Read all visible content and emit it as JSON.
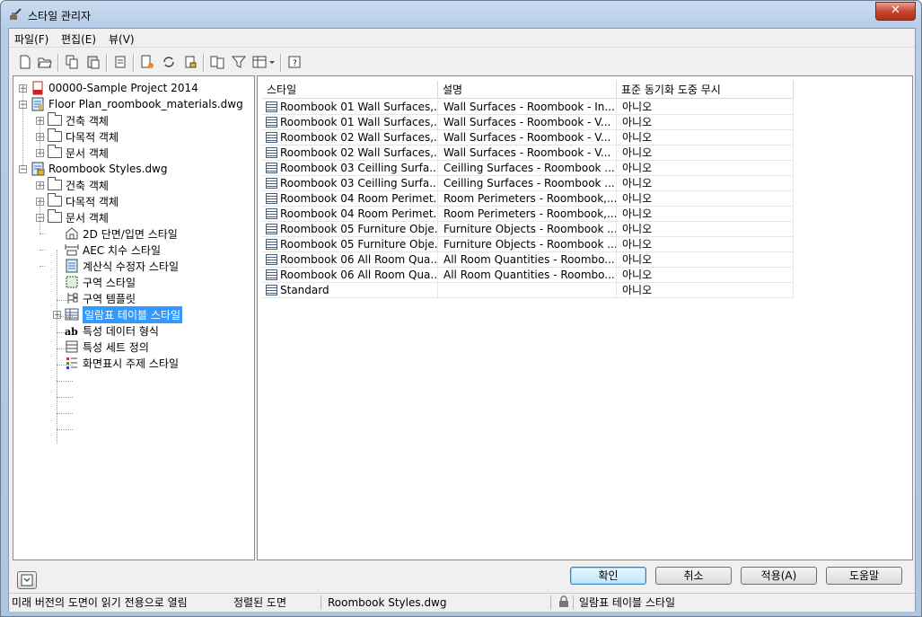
{
  "window": {
    "title": "스타일 관리자",
    "close_label": "✕"
  },
  "menu": [
    "파일(F)",
    "편집(E)",
    "뷰(V)"
  ],
  "toolbar": [
    "new-icon",
    "open-icon",
    "copy-icon",
    "paste-icon",
    "purge-icon",
    "edit-style-icon",
    "sync-icon",
    "lock-icon",
    "compare-icon",
    "filter-icon",
    "view-options-icon",
    "help-icon"
  ],
  "tree": [
    {
      "label": "00000-Sample Project 2014",
      "icon": "project-icon",
      "expander": "+"
    },
    {
      "label": "Floor Plan_roombook_materials.dwg",
      "icon": "drawing-icon",
      "expander": "−"
    },
    {
      "label": "건축 객체",
      "icon": "folder-icon",
      "expander": "+"
    },
    {
      "label": "다목적 객체",
      "icon": "folder-icon",
      "expander": "+"
    },
    {
      "label": "문서 객체",
      "icon": "folder-icon",
      "expander": "+"
    },
    {
      "label": "Roombook Styles.dwg",
      "icon": "locked-drawing-icon",
      "expander": "−"
    },
    {
      "label": "건축 객체",
      "icon": "folder-icon",
      "expander": "+"
    },
    {
      "label": "다목적 객체",
      "icon": "folder-icon",
      "expander": "+"
    },
    {
      "label": "문서 객체",
      "icon": "folder-icon",
      "expander": "−"
    },
    {
      "label": "2D 단면/입면 스타일",
      "icon": "section-icon"
    },
    {
      "label": "AEC 치수 스타일",
      "icon": "dimension-icon"
    },
    {
      "label": "계산식 수정자 스타일",
      "icon": "calculation-icon"
    },
    {
      "label": "구역 스타일",
      "icon": "zone-icon"
    },
    {
      "label": "구역 템플릿",
      "icon": "zone-template-icon"
    },
    {
      "label": "일람표 테이블 스타일",
      "icon": "schedule-table-icon",
      "expander": "+",
      "selected": true
    },
    {
      "label": "특성 데이터 형식",
      "icon": "property-format-icon"
    },
    {
      "label": "특성 세트 정의",
      "icon": "property-set-icon"
    },
    {
      "label": "화면표시 주제 스타일",
      "icon": "display-theme-icon"
    }
  ],
  "list": {
    "columns": [
      "스타일",
      "설명",
      "표준 동기화 도중 무시"
    ],
    "rows": [
      [
        "Roombook 01 Wall Surfaces,...",
        "Wall Surfaces - Roombook - In...",
        "아니오"
      ],
      [
        "Roombook 01 Wall Surfaces,...",
        "Wall Surfaces - Roombook - V...",
        "아니오"
      ],
      [
        "Roombook 02 Wall Surfaces,...",
        "Wall Surfaces - Roombook - V...",
        "아니오"
      ],
      [
        "Roombook 02 Wall Surfaces,...",
        "Wall Surfaces - Roombook - V...",
        "아니오"
      ],
      [
        "Roombook 03 Ceilling Surfa...",
        "Ceilling Surfaces - Roombook ...",
        "아니오"
      ],
      [
        "Roombook 03 Ceilling Surfa...",
        "Ceilling Surfaces - Roombook ...",
        "아니오"
      ],
      [
        "Roombook 04 Room Perimet...",
        "Room Perimeters - Roombook,...",
        "아니오"
      ],
      [
        "Roombook 04 Room Perimet...",
        "Room Perimeters - Roombook,...",
        "아니오"
      ],
      [
        "Roombook 05 Furniture Obje...",
        "Furniture Objects - Roombook ...",
        "아니오"
      ],
      [
        "Roombook 05 Furniture Obje...",
        "Furniture Objects - Roombook ...",
        "아니오"
      ],
      [
        "Roombook 06 All Room Qua...",
        "All Room Quantities - Roombo...",
        "아니오"
      ],
      [
        "Roombook 06 All Room Qua...",
        "All Room Quantities - Roombo...",
        "아니오"
      ],
      [
        "Standard",
        "",
        "아니오"
      ]
    ]
  },
  "buttons": {
    "ok": "확인",
    "cancel": "취소",
    "apply": "적용(A)",
    "help": "도움말"
  },
  "status": {
    "message": "미래 버전의 도면이 읽기 전용으로 열림",
    "sort": "정렬된 도면",
    "drawing": "Roombook Styles.dwg",
    "selection": "일람표 테이블 스타일"
  }
}
